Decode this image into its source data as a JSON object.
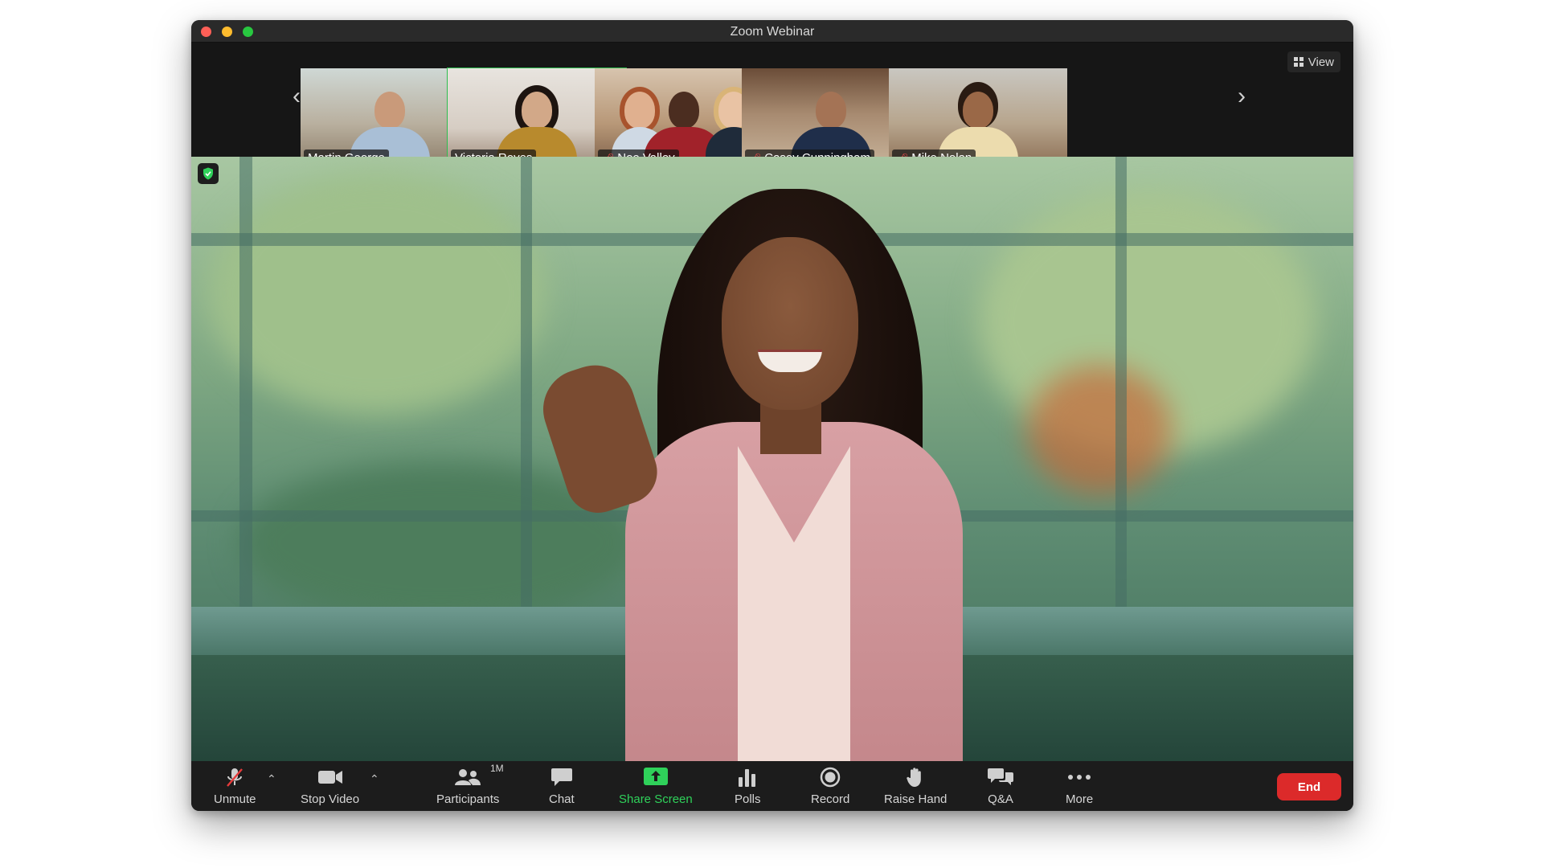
{
  "window": {
    "title": "Zoom Webinar"
  },
  "gallery": {
    "view_label": "View",
    "participants": [
      {
        "name": "Martin George",
        "muted": false
      },
      {
        "name": "Victoria Reyes",
        "muted": false,
        "active": true
      },
      {
        "name": "Noe Valley",
        "muted": true
      },
      {
        "name": "Casey Cunningham",
        "muted": true
      },
      {
        "name": "Mike Nolan",
        "muted": true
      }
    ]
  },
  "toolbar": {
    "unmute": "Unmute",
    "stop_video": "Stop Video",
    "participants": "Participants",
    "participants_count": "1M",
    "chat": "Chat",
    "share_screen": "Share Screen",
    "polls": "Polls",
    "record": "Record",
    "raise_hand": "Raise Hand",
    "qa": "Q&A",
    "more": "More",
    "end": "End"
  },
  "colors": {
    "accent_green": "#2fd15a",
    "end_red": "#dc2a2a",
    "active_border": "#2dbd4e"
  }
}
